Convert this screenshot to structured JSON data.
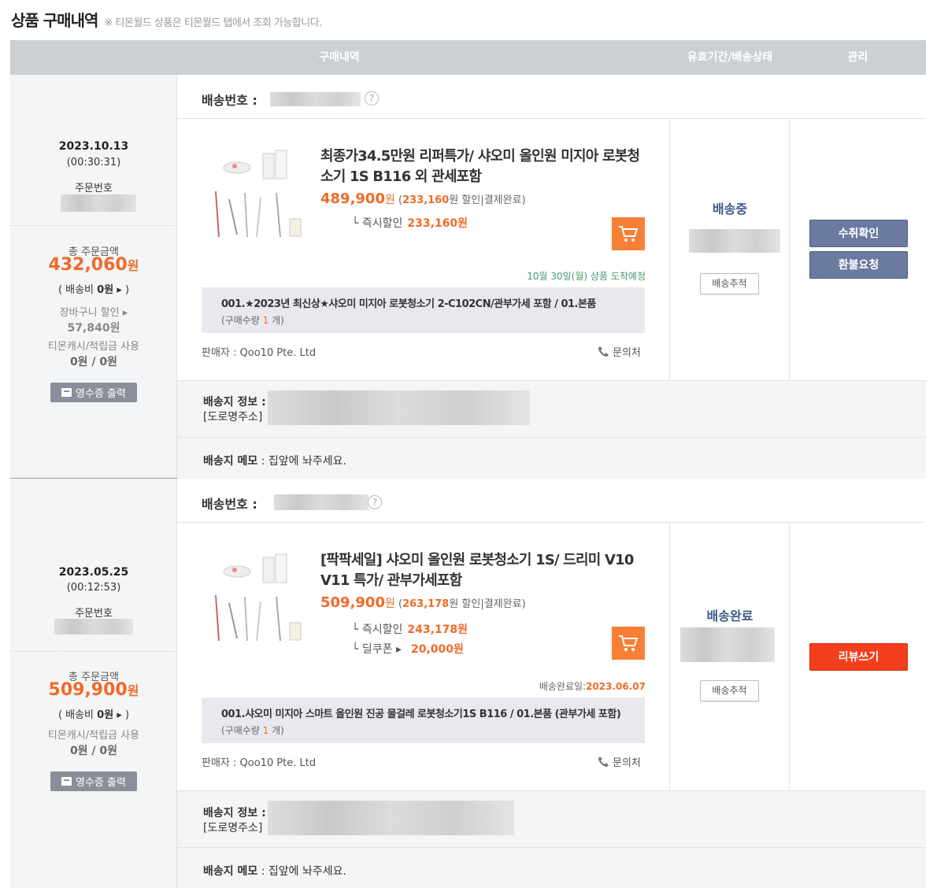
{
  "header": {
    "title": "상품 구매내역",
    "note": "※ 티몬월드 상품은 티몬월드 탭에서 조회 가능합니다."
  },
  "table_header": {
    "col1": "구매내역",
    "col2": "유효기간/배송상태",
    "col3": "관리"
  },
  "labels": {
    "order_no": "주문번호",
    "total": "총 주문금액",
    "won": "원",
    "ship_fee_prefix": "( 배송비 ",
    "ship_fee_suffix": "▸ )",
    "cart_discount": "장바구니 할인 ▸",
    "cash_points": "티몬캐시/적립금 사용",
    "receipt": "영수증 출력",
    "ship_no": "배송번호 :",
    "question": "?",
    "seller_prefix": "판매자 : ",
    "inquiry": "문의처",
    "track": "배송추적",
    "address_label": "배송지 정보 :",
    "address_sub": "[도로명주소]",
    "memo_label": "배송지 메모",
    "memo_sep": " : ",
    "discount_word": "할인",
    "paid": "결제완료",
    "instant_discount": "└ 즉시할인",
    "deal_coupon": "└ 딜쿠폰 ▸",
    "qty_prefix": "(구매수량 ",
    "qty_suffix": " 개)"
  },
  "orders": [
    {
      "date": "2023.10.13",
      "time": "(00:30:31)",
      "total": "432,060",
      "ship_fee": "0원",
      "cart_discount_value": "57,840원",
      "cash_value": "0원 / 0원",
      "product": {
        "title": "최종가34.5만원 리퍼특가/ 샤오미 올인원 미지아 로봇청소기 1S B116 외 관세포함",
        "price": "489,900",
        "discount": "233,160",
        "instant_discount": "233,160원",
        "eta": "10월 30일(월) 상품 도착예정",
        "option": "001.★2023년 최신상★샤오미 미지아 로봇청소기 2-C102CN/관부가세 포함 / 01.본품",
        "qty": "1",
        "seller": "Qoo10 Pte. Ltd"
      },
      "status": "배송중",
      "actions": [
        "수취확인",
        "환불요청"
      ],
      "memo": "집앞에 놔주세요."
    },
    {
      "date": "2023.05.25",
      "time": "(00:12:53)",
      "total": "509,900",
      "ship_fee": "0원",
      "cash_value": "0원 / 0원",
      "product": {
        "title": "[팍팍세일] 샤오미 올인원 로봇청소기 1S/ 드리미 V10 V11 특가/ 관부가세포함",
        "price": "509,900",
        "discount": "263,178",
        "instant_discount": "243,178원",
        "deal_coupon": "20,000원",
        "eta_label": "배송완료일:",
        "eta_value": "2023.06.07",
        "option": "001.샤오미 미지아 스마트 올인원 진공 물걸레 로봇청소기1S B116 / 01.본품 (관부가세 포함)",
        "qty": "1",
        "seller": "Qoo10 Pte. Ltd"
      },
      "status": "배송완료",
      "actions": [
        "리뷰쓰기"
      ],
      "memo": "집앞에 놔주세요."
    }
  ],
  "colors": {
    "accent_orange": "#f06a29",
    "header_gray": "#ccd0d3",
    "status_blue": "#3d5a8a",
    "eta_green": "#4c9a6a",
    "review_red": "#f43f1c"
  }
}
